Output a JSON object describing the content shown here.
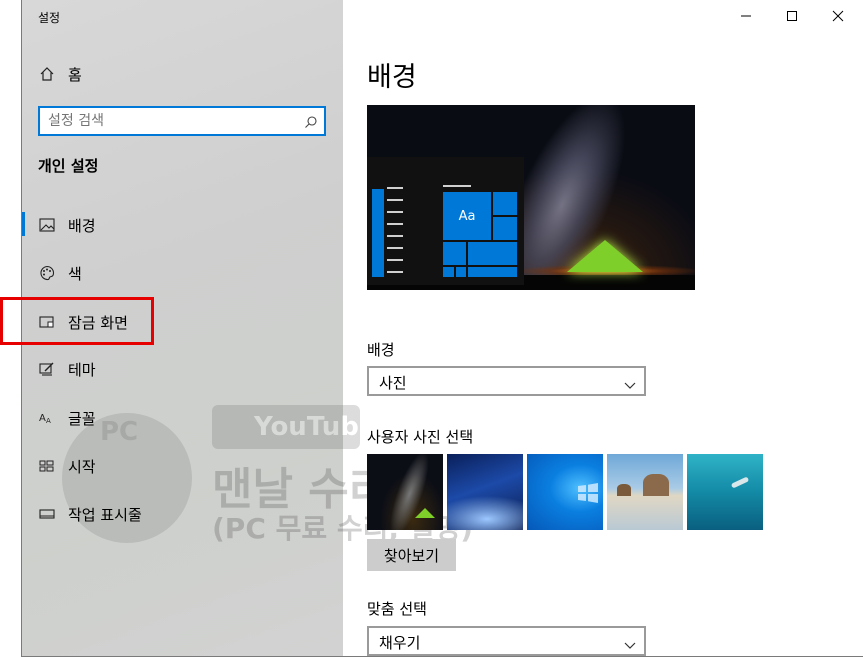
{
  "window": {
    "app_title": "설정",
    "controls": {
      "minimize": "—",
      "maximize": "☐",
      "close": "✕"
    }
  },
  "sidebar": {
    "home_label": "홈",
    "search_placeholder": "설정 검색",
    "section_title": "개인 설정",
    "items": [
      {
        "label": "배경",
        "icon": "picture-icon",
        "active": true
      },
      {
        "label": "색",
        "icon": "palette-icon",
        "active": false
      },
      {
        "label": "잠금 화면",
        "icon": "lock-screen-icon",
        "active": false,
        "highlighted": true
      },
      {
        "label": "테마",
        "icon": "brush-icon",
        "active": false
      },
      {
        "label": "글꼴",
        "icon": "font-icon",
        "active": false
      },
      {
        "label": "시작",
        "icon": "start-icon",
        "active": false
      },
      {
        "label": "작업 표시줄",
        "icon": "taskbar-icon",
        "active": false
      }
    ]
  },
  "watermark": {
    "badge_text": "PC",
    "youtube": "YouTube",
    "line2": "맨날 수리",
    "line3": "(PC 무료 수리, 설명)"
  },
  "main": {
    "page_title": "배경",
    "preview": {
      "tile_text": "Aa"
    },
    "background": {
      "label": "배경",
      "value": "사진"
    },
    "choose_photo": {
      "label": "사용자 사진 선택",
      "thumbnails": [
        "milky-way-tent",
        "blue-night-sky",
        "windows-logo-blue",
        "beach-rocks",
        "underwater-swimmer"
      ],
      "browse_label": "찾아보기"
    },
    "fit": {
      "label": "맞춤 선택",
      "value": "채우기"
    }
  },
  "colors": {
    "accent": "#0078d7",
    "highlight": "#e60000",
    "sidebar_bg": "#d3d3d3"
  }
}
